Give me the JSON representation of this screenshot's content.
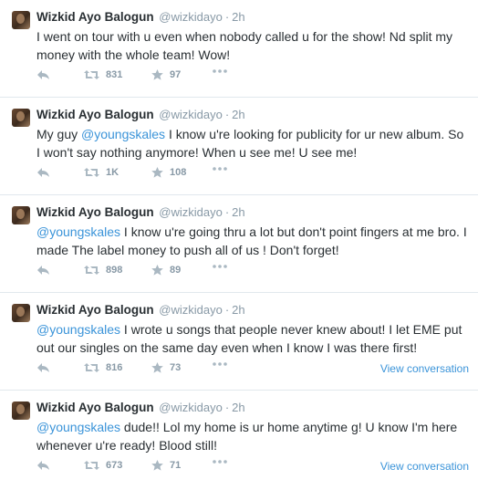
{
  "tweets": [
    {
      "name": "Wizkid Ayo Balogun",
      "handle": "@wizkidayo",
      "separator": "·",
      "time": "2h",
      "text_parts": [
        "I went on tour with u even when nobody called u for the show! Nd split my money with the whole team! Wow!"
      ],
      "mention": "",
      "retweets": "831",
      "favorites": "97",
      "view_conversation": ""
    },
    {
      "name": "Wizkid Ayo Balogun",
      "handle": "@wizkidayo",
      "separator": "·",
      "time": "2h",
      "text_before": "My guy ",
      "mention": "@youngskales",
      "text_after": " I know u're looking for publicity for ur new album. So I won't say nothing anymore! When u see me! U see me!",
      "retweets": "1K",
      "favorites": "108",
      "view_conversation": ""
    },
    {
      "name": "Wizkid Ayo Balogun",
      "handle": "@wizkidayo",
      "separator": "·",
      "time": "2h",
      "text_before": "",
      "mention": "@youngskales",
      "text_after": " I know u're going thru a lot but don't point fingers at me bro. I made The label money to push all of us ! Don't forget!",
      "retweets": "898",
      "favorites": "89",
      "view_conversation": ""
    },
    {
      "name": "Wizkid Ayo Balogun",
      "handle": "@wizkidayo",
      "separator": "·",
      "time": "2h",
      "text_before": "",
      "mention": "@youngskales",
      "text_after": " I wrote u songs that people never knew about! I let EME put out our singles on the same day even when I know I was there first!",
      "retweets": "816",
      "favorites": "73",
      "view_conversation": "View conversation"
    },
    {
      "name": "Wizkid Ayo Balogun",
      "handle": "@wizkidayo",
      "separator": "·",
      "time": "2h",
      "text_before": "",
      "mention": "@youngskales",
      "text_after": " dude!! Lol my home is ur home anytime g! U know I'm here whenever u're ready! Blood still!",
      "retweets": "673",
      "favorites": "71",
      "view_conversation": "View conversation"
    }
  ],
  "icons": {
    "reply": "reply-icon",
    "retweet": "retweet-icon",
    "favorite": "star-icon",
    "more": "more-dots-icon"
  },
  "colors": {
    "mention": "#3b94d9",
    "muted": "#8899a6",
    "text": "#292f33",
    "divider": "#e1e8ed"
  }
}
